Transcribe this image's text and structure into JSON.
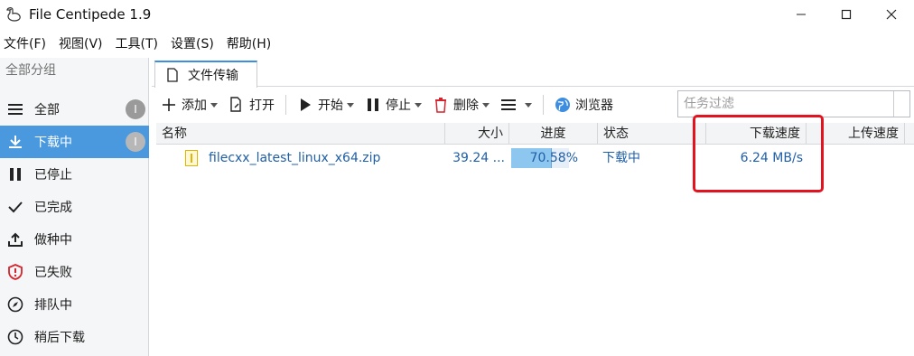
{
  "window": {
    "title": "File Centipede 1.9"
  },
  "menu": [
    {
      "label": "文件(F)"
    },
    {
      "label": "视图(V)"
    },
    {
      "label": "工具(T)"
    },
    {
      "label": "设置(S)"
    },
    {
      "label": "帮助(H)"
    }
  ],
  "sidebar": {
    "header": "全部分组",
    "items": [
      {
        "label": "全部",
        "icon": "menu-icon",
        "count": "I",
        "active": false
      },
      {
        "label": "下载中",
        "icon": "download-icon",
        "count": "I",
        "active": true
      },
      {
        "label": "已停止",
        "icon": "pause-icon",
        "active": false
      },
      {
        "label": "已完成",
        "icon": "check-icon",
        "active": false
      },
      {
        "label": "做种中",
        "icon": "upload-icon",
        "active": false
      },
      {
        "label": "已失败",
        "icon": "shield-alert-icon",
        "active": false
      },
      {
        "label": "排队中",
        "icon": "compass-icon",
        "active": false
      },
      {
        "label": "稍后下载",
        "icon": "clock-icon",
        "active": false
      }
    ]
  },
  "tab": {
    "label": "文件传输"
  },
  "toolbar": {
    "add": "添加",
    "open": "打开",
    "start": "开始",
    "stop": "停止",
    "delete": "删除",
    "browser": "浏览器",
    "filter_placeholder": "任务过滤"
  },
  "table": {
    "columns": [
      "名称",
      "大小",
      "进度",
      "状态",
      "下载速度",
      "上传速度"
    ],
    "rows": [
      {
        "name": "filecxx_latest_linux_x64.zip",
        "size": "39.24 ...",
        "progress_text": "70.58%",
        "progress": 0.7058,
        "status": "下载中",
        "download_speed": "6.24 MB/s",
        "upload_speed": ""
      }
    ]
  },
  "colors": {
    "accent": "#4a98de",
    "highlight": "#e3121f",
    "progress": "#8dc6ef"
  }
}
